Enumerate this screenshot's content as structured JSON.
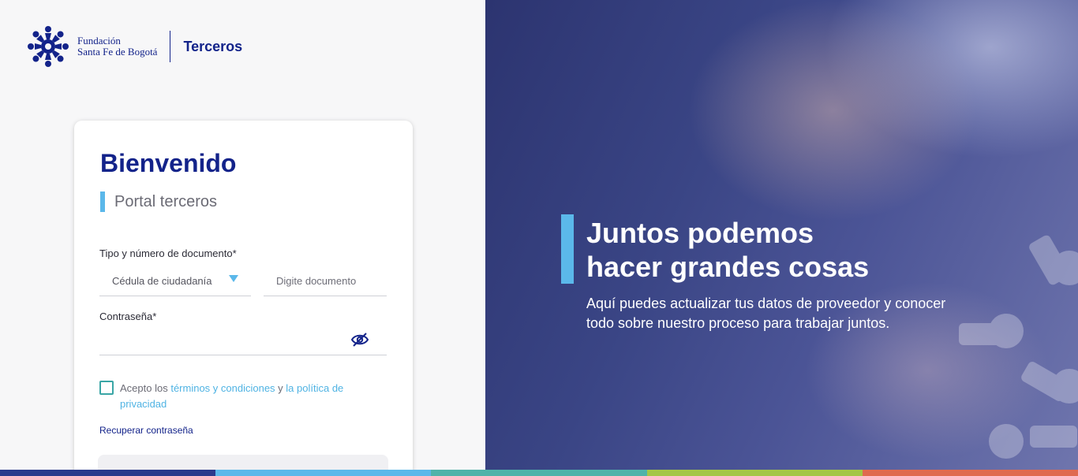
{
  "brand": {
    "name_line1": "Fundación",
    "name_line2": "Santa Fe de Bogotá",
    "app": "Terceros",
    "logo_icon": "foundation-logo-icon"
  },
  "login": {
    "title": "Bienvenido",
    "subtitle": "Portal terceros",
    "doc_label": "Tipo y número de documento*",
    "doc_type_value": "Cédula de ciudadanía",
    "doc_number_placeholder": "Digite documento",
    "password_label": "Contraseña*",
    "password_value": "",
    "eye_icon": "eye-slash-icon",
    "terms_prefix": "Acepto los ",
    "terms_link": "términos y condiciones",
    "terms_mid": " y ",
    "privacy_link": "la política de privacidad",
    "recover": "Recuperar contraseña"
  },
  "hero": {
    "title_line1": "Juntos podemos",
    "title_line2": "hacer grandes cosas",
    "text": "Aquí puedes actualizar tus datos de proveedor y conocer todo sobre nuestro proceso para trabajar juntos."
  },
  "colors": {
    "brand_blue": "#13238a",
    "accent_light_blue": "#5bb8ea",
    "checkbox_teal": "#3aa6a6",
    "strip": [
      "#2c3a8c",
      "#5bb8ea",
      "#4fb3a9",
      "#a4c646",
      "#e06a4f"
    ]
  }
}
